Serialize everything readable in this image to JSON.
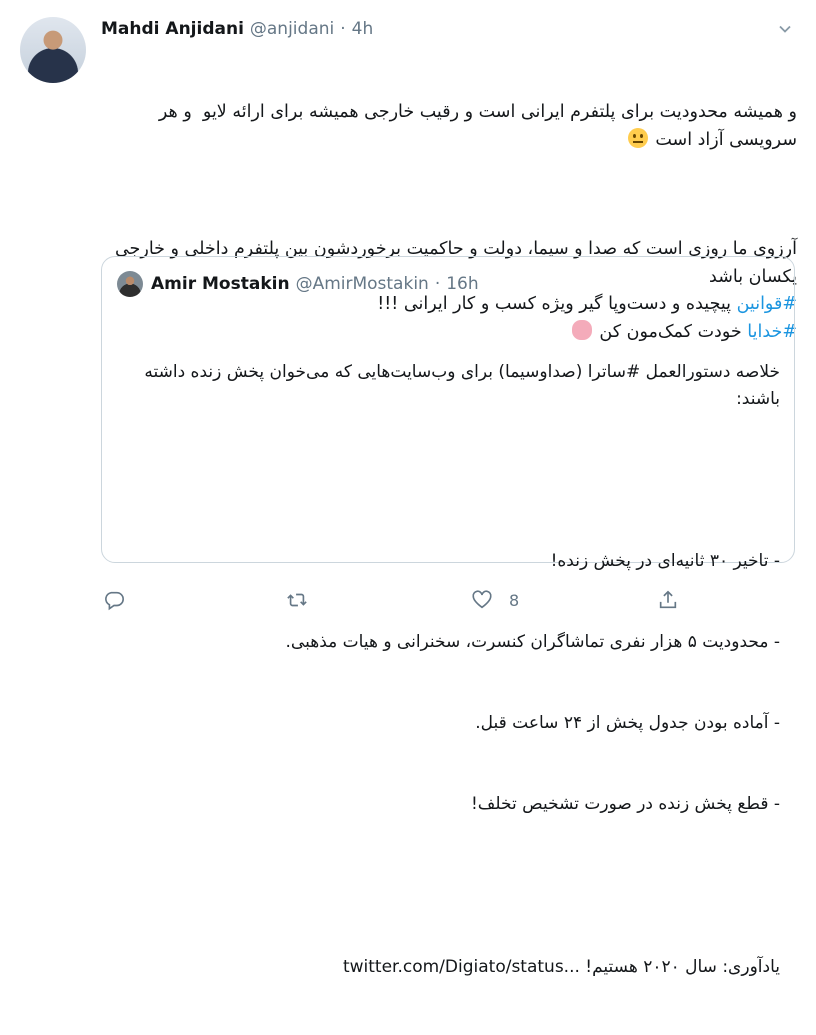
{
  "author": {
    "name": "Mahdi Anjidani",
    "handle": "@anjidani",
    "separator": "·",
    "time": "4h"
  },
  "menu": {
    "caret_icon": "chevron-down-icon"
  },
  "tweet": {
    "line1": "و همیشه محدودیت برای پلتفرم ایرانی است و رقیب خارجی همیشه برای ارائه لایو  و هر سرویسی آزاد است ",
    "line2": "آرزوی ما روزی است که صدا و سیما، دولت و حاکمیت برخوردشون بین پلتفرم داخلی و خارجی یکسان باشد",
    "hashtag1": "#قوانین",
    "line3_rest": " پیچیده و دست‌وپا گیر ویژه کسب و کار ایرانی !!!",
    "hashtag2": "#خدایا",
    "line4_rest": " خودت کمک‌مون کن ",
    "emoji1": "neutral-face-emoji",
    "emoji2": "brain-emoji"
  },
  "quote": {
    "name": "Amir Mostakin",
    "handle": "@AmirMostakin",
    "separator": "·",
    "time": "16h",
    "lines": [
      "خلاصه دستورالعمل #ساترا (صداوسیما) برای وب‌سایت‌هایی که می‌خوان پخش زنده داشته باشند:",
      "",
      "- تاخیر ۳۰ ثانیه‌ای در پخش زنده!",
      "- محدودیت ۵ هزار نفری تماشاگران کنسرت، سخنرانی و هیات مذهبی.",
      "- آماده بودن جدول پخش از ۲۴ ساعت قبل.",
      "- قطع پخش زنده در صورت تشخیص تخلف!",
      ""
    ],
    "last_line_text": "یادآوری: سال ۲۰۲۰ هستیم! ",
    "last_line_link": "twitter.com/Digiato/status..."
  },
  "actions": {
    "reply_icon": "reply-icon",
    "retweet_icon": "retweet-icon",
    "like_icon": "heart-icon",
    "like_count": "8",
    "share_icon": "share-icon"
  }
}
